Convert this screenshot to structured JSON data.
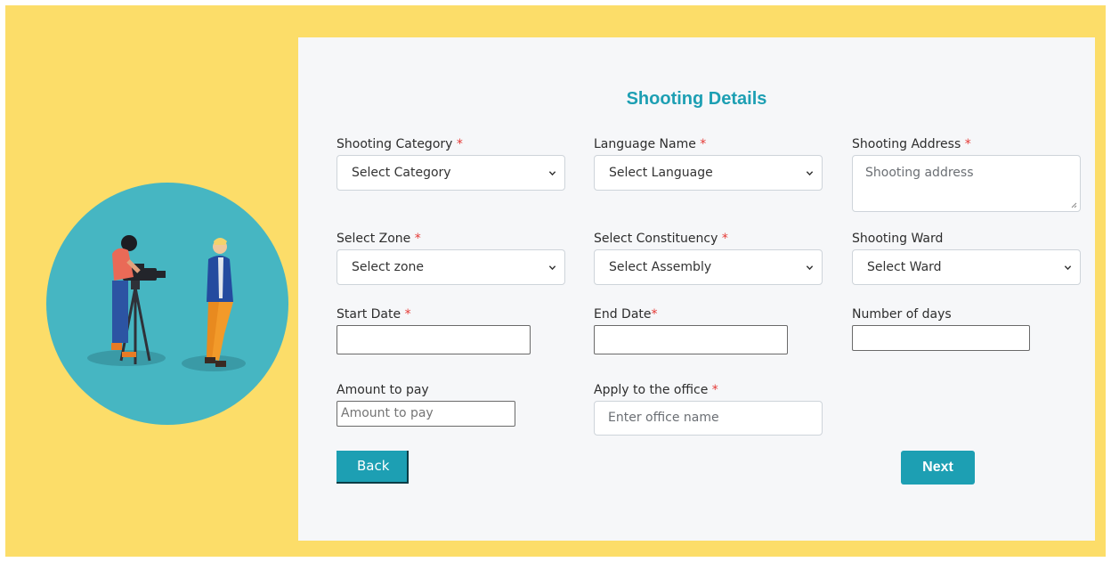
{
  "form": {
    "title": "Shooting Details",
    "required_mark": "*",
    "fields": {
      "shooting_category": {
        "label": "Shooting Category",
        "value": "Select Category"
      },
      "language_name": {
        "label": "Language Name",
        "value": "Select Language"
      },
      "shooting_address": {
        "label": "Shooting Address",
        "placeholder": "Shooting address"
      },
      "select_zone": {
        "label": "Select Zone",
        "value": "Select zone"
      },
      "select_constituency": {
        "label": "Select Constituency",
        "value": "Select Assembly"
      },
      "shooting_ward": {
        "label": "Shooting Ward",
        "value": "Select Ward"
      },
      "start_date": {
        "label": "Start Date",
        "value": ""
      },
      "end_date": {
        "label": "End Date",
        "value": ""
      },
      "number_of_days": {
        "label": "Number of days",
        "value": ""
      },
      "amount_to_pay": {
        "label": "Amount to pay",
        "placeholder": "Amount to pay"
      },
      "apply_to_office": {
        "label": "Apply to the office",
        "placeholder": "Enter office name"
      }
    },
    "buttons": {
      "back": "Back",
      "next": "Next"
    }
  },
  "colors": {
    "frame_background": "#fcdd69",
    "panel_background": "#f6f7f9",
    "accent": "#1d9fb3",
    "required": "#e53935",
    "illustration_circle": "#46b6c2"
  },
  "icons": {
    "illustration": "film-shooting-illustration",
    "dropdown": "chevron-down-icon",
    "resize": "resize-grip-icon"
  }
}
